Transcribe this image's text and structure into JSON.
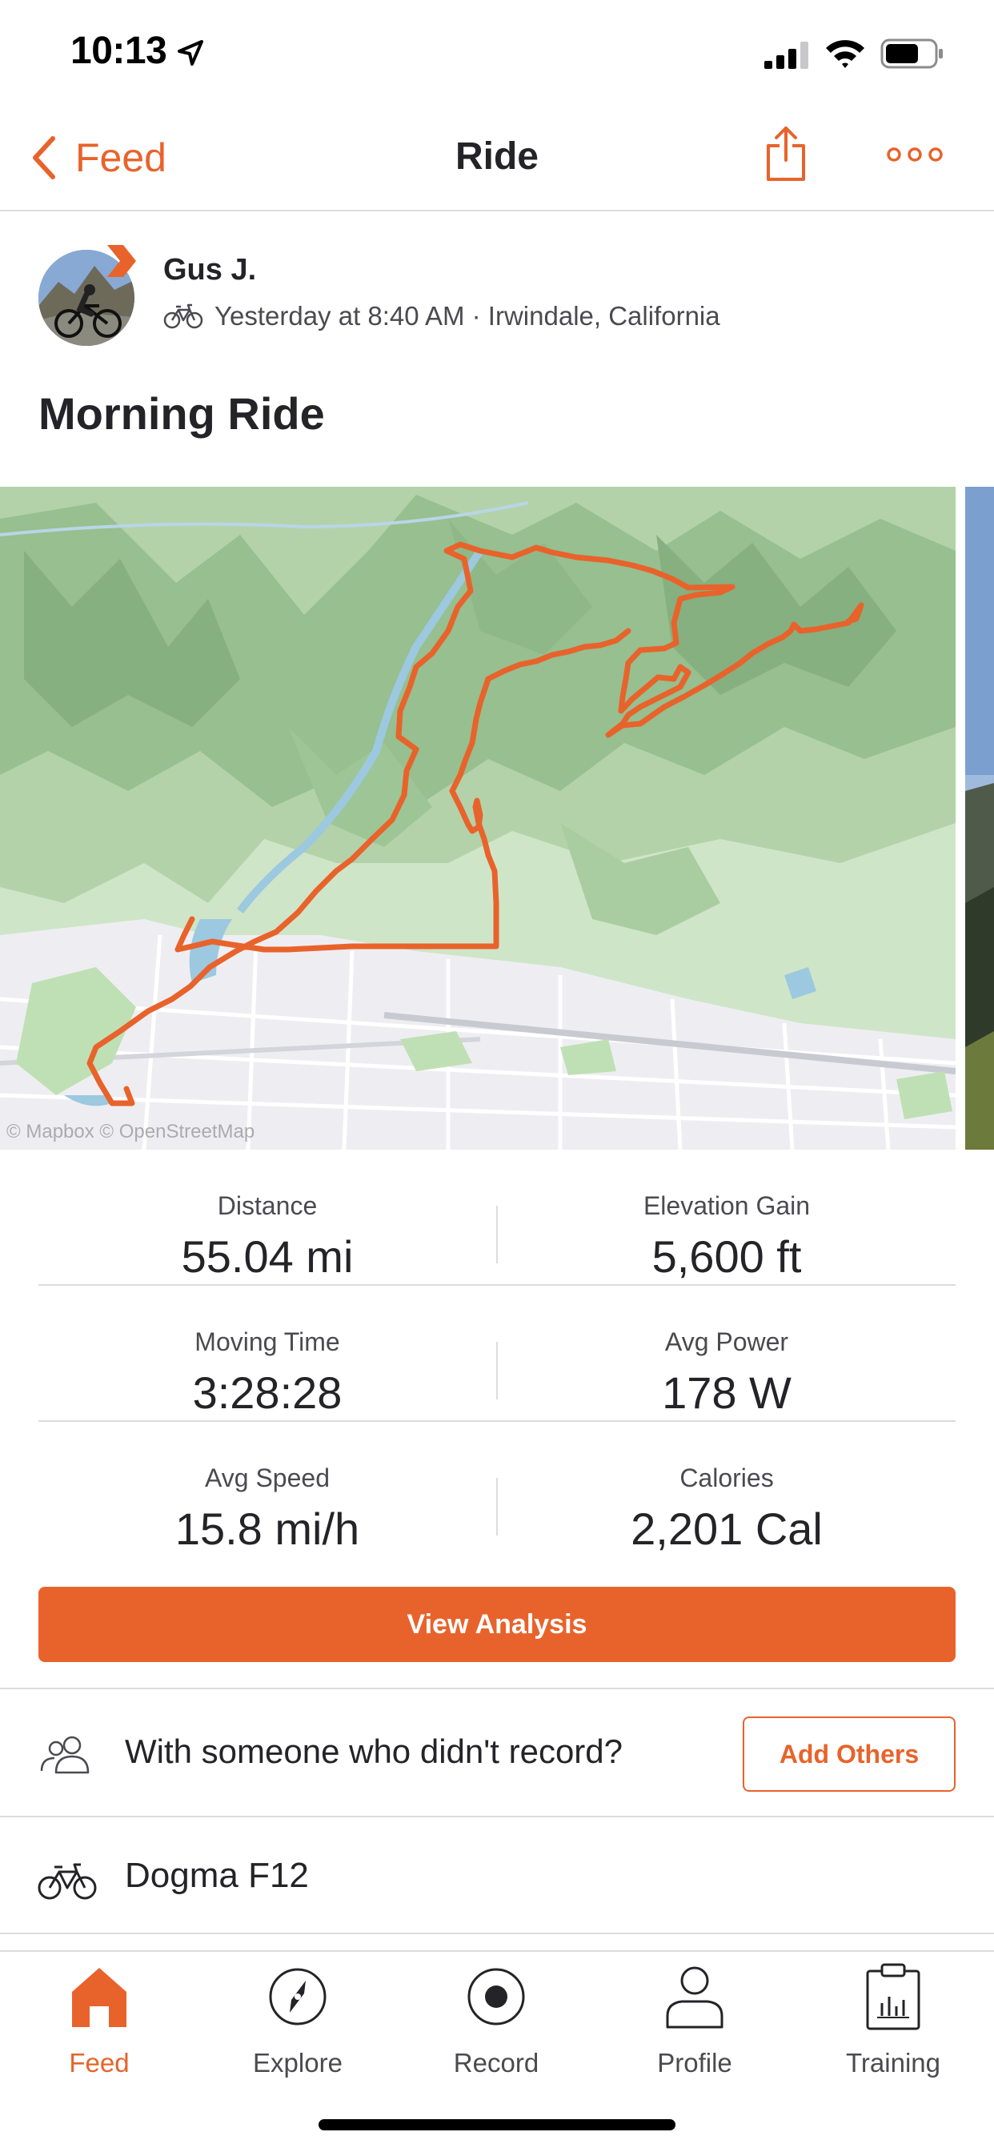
{
  "status_bar": {
    "time": "10:13"
  },
  "nav": {
    "back_label": "Feed",
    "title": "Ride"
  },
  "activity": {
    "athlete": "Gus J.",
    "meta": "Yesterday at 8:40 AM · Irwindale, California",
    "title": "Morning Ride"
  },
  "map": {
    "attribution": "© Mapbox © OpenStreetMap",
    "route_color": "#e8632b"
  },
  "stats": [
    [
      {
        "label": "Distance",
        "value": "55.04 mi"
      },
      {
        "label": "Elevation Gain",
        "value": "5,600 ft"
      }
    ],
    [
      {
        "label": "Moving Time",
        "value": "3:28:28"
      },
      {
        "label": "Avg Power",
        "value": "178 W"
      }
    ],
    [
      {
        "label": "Avg Speed",
        "value": "15.8 mi/h"
      },
      {
        "label": "Calories",
        "value": "2,201 Cal"
      }
    ]
  ],
  "view_analysis_label": "View Analysis",
  "with_others": {
    "text": "With someone who didn't record?",
    "button": "Add Others"
  },
  "gear": {
    "name": "Dogma F12"
  },
  "tabs": [
    {
      "label": "Feed",
      "icon": "home-icon",
      "active": true
    },
    {
      "label": "Explore",
      "icon": "compass-icon",
      "active": false
    },
    {
      "label": "Record",
      "icon": "record-icon",
      "active": false
    },
    {
      "label": "Profile",
      "icon": "profile-icon",
      "active": false
    },
    {
      "label": "Training",
      "icon": "clipboard-chart-icon",
      "active": false
    }
  ],
  "colors": {
    "accent": "#e8632b",
    "text": "#242428",
    "secondary_text": "#4a4a50",
    "divider": "#dcdce0"
  }
}
